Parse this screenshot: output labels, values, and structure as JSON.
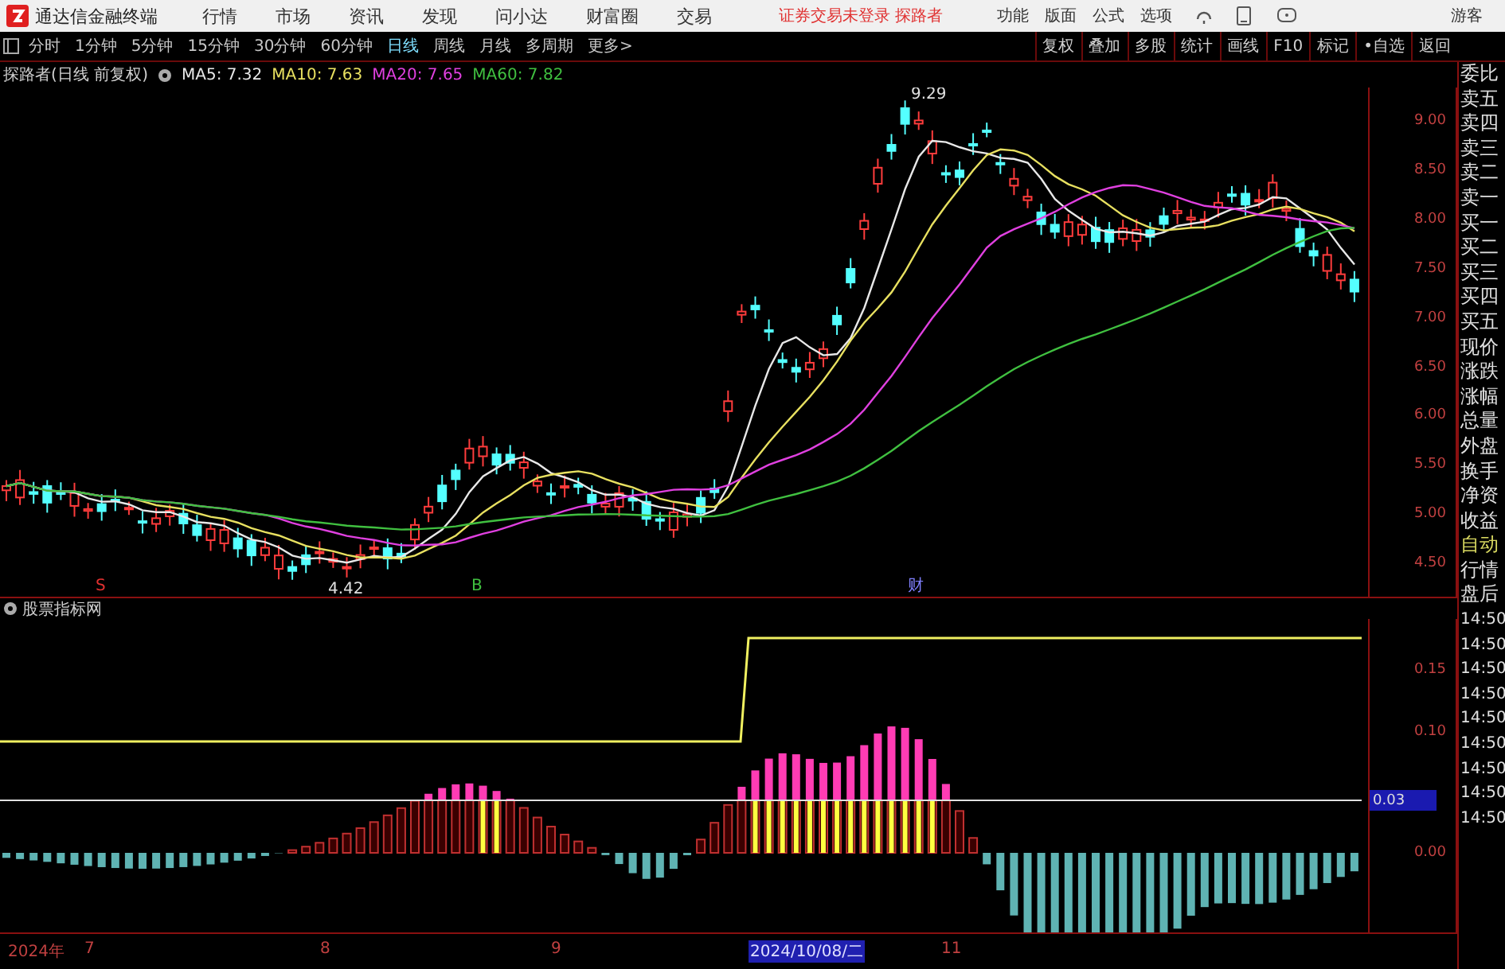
{
  "menu_bar": {
    "app_title": "通达信金融终端",
    "menus": [
      "行情",
      "市场",
      "资讯",
      "发现",
      "问小达",
      "财富圈",
      "交易"
    ],
    "login_notice": "证券交易未登录 探路者",
    "tools": [
      "功能",
      "版面",
      "公式",
      "选项"
    ],
    "user": "游客"
  },
  "period_tabs": [
    {
      "label": "分时",
      "selected": false
    },
    {
      "label": "1分钟",
      "selected": false
    },
    {
      "label": "5分钟",
      "selected": false
    },
    {
      "label": "15分钟",
      "selected": false
    },
    {
      "label": "30分钟",
      "selected": false
    },
    {
      "label": "60分钟",
      "selected": false
    },
    {
      "label": "日线",
      "selected": true
    },
    {
      "label": "周线",
      "selected": false
    },
    {
      "label": "月线",
      "selected": false
    },
    {
      "label": "多周期",
      "selected": false
    },
    {
      "label": "更多>",
      "selected": false
    }
  ],
  "chart_buttons": [
    "复权",
    "叠加",
    "多股",
    "统计",
    "画线",
    "F10",
    "标记",
    "•自选",
    "返回"
  ],
  "main_chart": {
    "title": "探路者(日线 前复权)",
    "moving_averages": [
      {
        "label": "MA5: 7.32",
        "color": "#e8e8e8"
      },
      {
        "label": "MA10: 7.63",
        "color": "#e8e060"
      },
      {
        "label": "MA20: 7.65",
        "color": "#e040e0"
      },
      {
        "label": "MA60: 7.82",
        "color": "#40c040"
      }
    ],
    "high_label": "9.29",
    "low_label": "4.42",
    "markers": [
      {
        "text": "S",
        "color": "#e03030"
      },
      {
        "text": "B",
        "color": "#40c040"
      },
      {
        "text": "财",
        "color": "#8080ff"
      }
    ],
    "price_ticks": [
      "9.00",
      "8.50",
      "8.00",
      "7.50",
      "7.00",
      "6.50",
      "6.00",
      "5.50",
      "5.00",
      "4.50"
    ]
  },
  "indicator": {
    "title": "股票指标网",
    "ticks": [
      "0.15",
      "0.10",
      "0.00"
    ],
    "current_value": "0.03"
  },
  "time_axis": {
    "labels": [
      "2024年",
      "7",
      "8",
      "9",
      "2024/10/08/二",
      "11"
    ]
  },
  "side_panel": [
    {
      "label": "委比",
      "kind": "field"
    },
    {
      "label": "卖五",
      "kind": "field"
    },
    {
      "label": "卖四",
      "kind": "field"
    },
    {
      "label": "卖三",
      "kind": "field"
    },
    {
      "label": "卖二",
      "kind": "field"
    },
    {
      "label": "卖一",
      "kind": "field"
    },
    {
      "label": "买一",
      "kind": "field"
    },
    {
      "label": "买二",
      "kind": "field"
    },
    {
      "label": "买三",
      "kind": "field"
    },
    {
      "label": "买四",
      "kind": "field"
    },
    {
      "label": "买五",
      "kind": "field"
    },
    {
      "label": "现价",
      "kind": "field"
    },
    {
      "label": "涨跌",
      "kind": "field"
    },
    {
      "label": "涨幅",
      "kind": "field"
    },
    {
      "label": "总量",
      "kind": "field"
    },
    {
      "label": "外盘",
      "kind": "field"
    },
    {
      "label": "换手",
      "kind": "field"
    },
    {
      "label": "净资",
      "kind": "field"
    },
    {
      "label": "收益",
      "kind": "field"
    },
    {
      "label": "自动",
      "kind": "mode"
    },
    {
      "label": "行情",
      "kind": "field"
    },
    {
      "label": "盘后",
      "kind": "field"
    },
    {
      "label": "14:50",
      "kind": "time"
    },
    {
      "label": "14:50",
      "kind": "time"
    },
    {
      "label": "14:50",
      "kind": "time"
    },
    {
      "label": "14:50",
      "kind": "time"
    },
    {
      "label": "14:50",
      "kind": "time"
    },
    {
      "label": "14:50",
      "kind": "time"
    },
    {
      "label": "14:50",
      "kind": "time"
    },
    {
      "label": "14:50",
      "kind": "time"
    },
    {
      "label": "14:50",
      "kind": "time"
    }
  ]
}
